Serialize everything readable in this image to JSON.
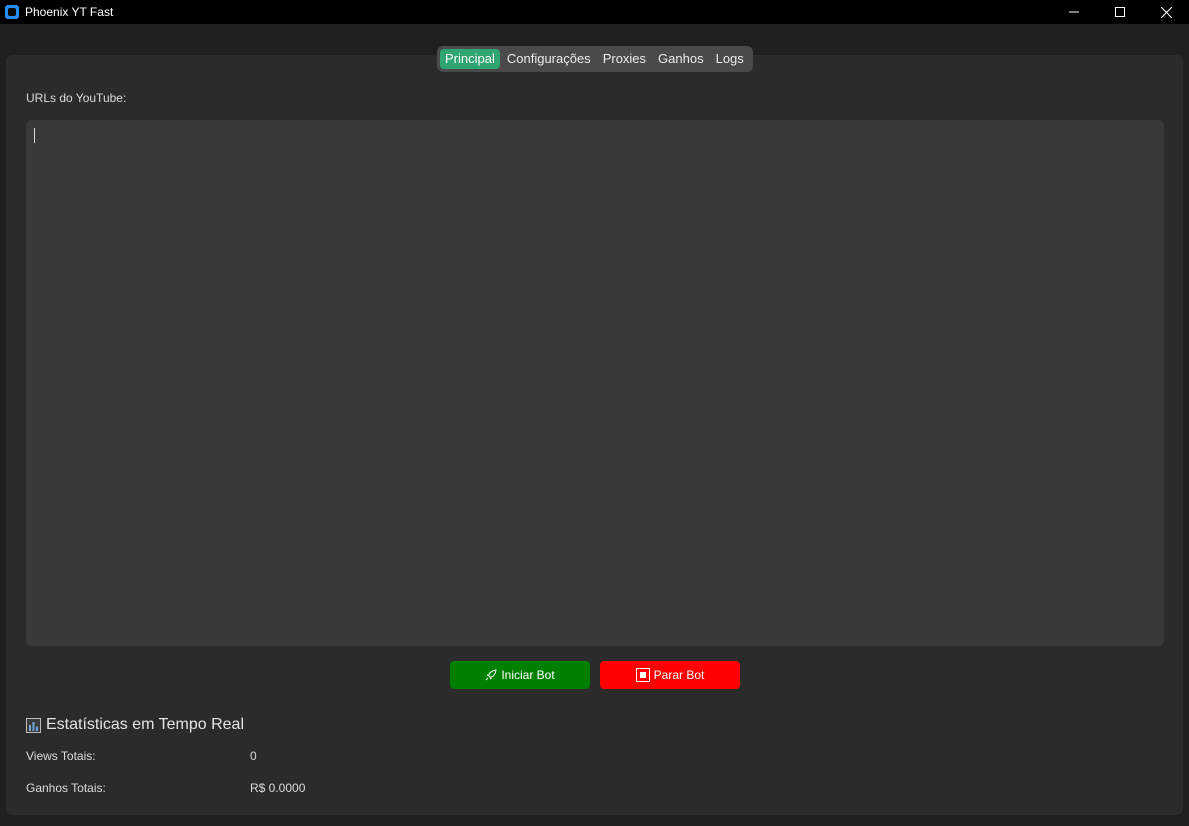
{
  "window": {
    "title": "Phoenix YT Fast"
  },
  "tabs": [
    {
      "label": "Principal",
      "active": true
    },
    {
      "label": "Configurações",
      "active": false
    },
    {
      "label": "Proxies",
      "active": false
    },
    {
      "label": "Ganhos",
      "active": false
    },
    {
      "label": "Logs",
      "active": false
    }
  ],
  "main": {
    "urls_label": "URLs do YouTube:",
    "urls_value": ""
  },
  "buttons": {
    "start_label": "Iniciar Bot",
    "start_icon": "rocket-icon",
    "stop_label": "Parar Bot",
    "stop_icon": "stop-icon"
  },
  "stats": {
    "title": "Estatísticas em Tempo Real",
    "title_icon": "bar-chart-icon",
    "views_label": "Views Totais:",
    "views_value": "0",
    "earnings_label": "Ganhos Totais:",
    "earnings_value": "R$ 0.0000"
  },
  "colors": {
    "accent_tab": "#2fa572",
    "start_button": "#008000",
    "stop_button": "#ff0000",
    "app_icon": "#1e90ff"
  }
}
